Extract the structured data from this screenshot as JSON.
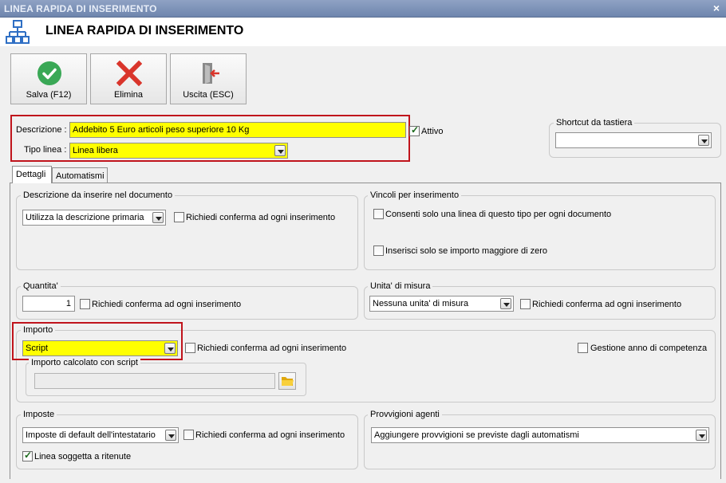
{
  "window": {
    "title": "LINEA RAPIDA DI INSERIMENTO",
    "close_glyph": "×"
  },
  "header": {
    "title": "LINEA RAPIDA DI INSERIMENTO",
    "icon": "network-structure-icon"
  },
  "toolbar": {
    "save_label": "Salva (F12)",
    "delete_label": "Elimina",
    "exit_label": "Uscita (ESC)"
  },
  "main": {
    "descrizione_label": "Descrizione :",
    "descrizione_value": "Addebito 5 Euro articoli peso superiore 10 Kg",
    "attivo_label": "Attivo",
    "attivo_checked": true,
    "tipo_linea_label": "Tipo linea :",
    "tipo_linea_value": "Linea libera",
    "shortcut_label": "Shortcut da tastiera",
    "shortcut_value": ""
  },
  "tabs": [
    {
      "label": "Dettagli",
      "active": true
    },
    {
      "label": "Automatismi",
      "active": false
    }
  ],
  "dettagli": {
    "descrizione_doc": {
      "title": "Descrizione da inserire nel documento",
      "select_value": "Utilizza la descrizione primaria",
      "confirm_label": "Richiedi conferma ad ogni inserimento"
    },
    "vincoli": {
      "title": "Vincoli per inserimento",
      "opt1_label": "Consenti solo una linea di questo tipo per ogni documento",
      "opt2_label": "Inserisci solo se importo maggiore di zero"
    },
    "quantita": {
      "title": "Quantita'",
      "value": "1",
      "confirm_label": "Richiedi conferma ad ogni inserimento"
    },
    "unita": {
      "title": "Unita' di misura",
      "select_value": "Nessuna unita' di misura",
      "confirm_label": "Richiedi conferma ad ogni inserimento"
    },
    "importo": {
      "title": "Importo",
      "select_value": "Script",
      "confirm_label": "Richiedi conferma ad ogni inserimento",
      "gestione_label": "Gestione anno di competenza",
      "script_title": "Importo calcolato con script",
      "script_value": ""
    },
    "imposte": {
      "title": "Imposte",
      "select_value": "Imposte di default dell'intestatario",
      "confirm_label": "Richiedi conferma ad ogni inserimento",
      "ritenute_label": "Linea soggetta a ritenute",
      "ritenute_checked": true
    },
    "provvigioni": {
      "title": "Provvigioni agenti",
      "select_value": "Aggiungere provvigioni se previste dagli automatismi"
    }
  },
  "colors": {
    "highlight": "#ffff00",
    "frame_red": "#c0141c",
    "save_green": "#3aa856",
    "delete_red": "#d9352b"
  }
}
